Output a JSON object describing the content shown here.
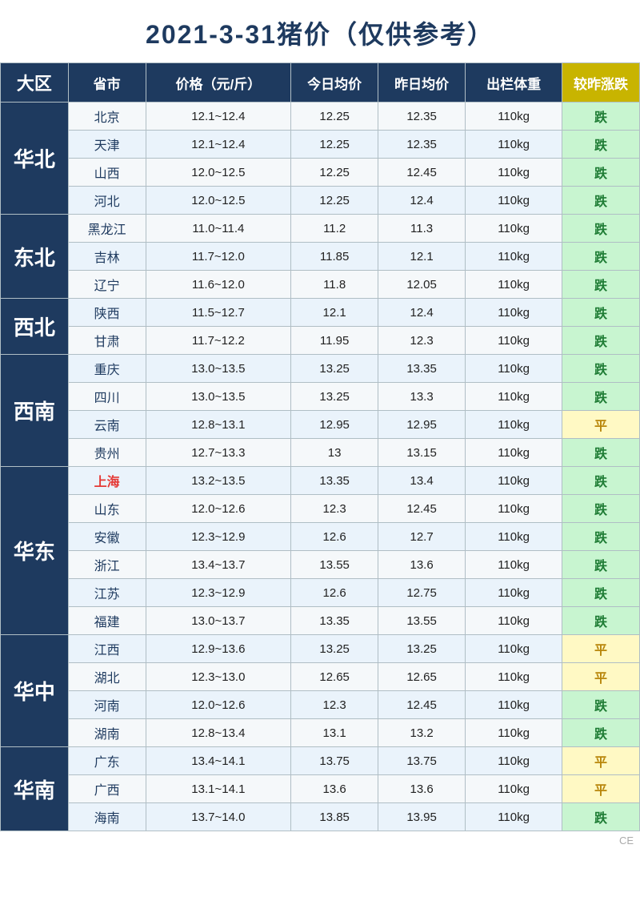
{
  "title": "2021-3-31猪价（仅供参考）",
  "headers": {
    "region": "大区",
    "province": "省市",
    "price": "价格（元/斤）",
    "today_avg": "今日均价",
    "yesterday_avg": "昨日均价",
    "weight": "出栏体重",
    "change": "较昨涨跌"
  },
  "regions": [
    {
      "name": "华北",
      "rows": [
        {
          "province": "北京",
          "price": "12.1~12.4",
          "today": "12.25",
          "yesterday": "12.35",
          "weight": "110kg",
          "change": "跌",
          "change_type": "drop",
          "province_highlight": false
        },
        {
          "province": "天津",
          "price": "12.1~12.4",
          "today": "12.25",
          "yesterday": "12.35",
          "weight": "110kg",
          "change": "跌",
          "change_type": "drop",
          "province_highlight": false
        },
        {
          "province": "山西",
          "price": "12.0~12.5",
          "today": "12.25",
          "yesterday": "12.45",
          "weight": "110kg",
          "change": "跌",
          "change_type": "drop",
          "province_highlight": false
        },
        {
          "province": "河北",
          "price": "12.0~12.5",
          "today": "12.25",
          "yesterday": "12.4",
          "weight": "110kg",
          "change": "跌",
          "change_type": "drop",
          "province_highlight": false
        }
      ]
    },
    {
      "name": "东北",
      "rows": [
        {
          "province": "黑龙江",
          "price": "11.0~11.4",
          "today": "11.2",
          "yesterday": "11.3",
          "weight": "110kg",
          "change": "跌",
          "change_type": "drop",
          "province_highlight": false
        },
        {
          "province": "吉林",
          "price": "11.7~12.0",
          "today": "11.85",
          "yesterday": "12.1",
          "weight": "110kg",
          "change": "跌",
          "change_type": "drop",
          "province_highlight": false
        },
        {
          "province": "辽宁",
          "price": "11.6~12.0",
          "today": "11.8",
          "yesterday": "12.05",
          "weight": "110kg",
          "change": "跌",
          "change_type": "drop",
          "province_highlight": false
        }
      ]
    },
    {
      "name": "西北",
      "rows": [
        {
          "province": "陕西",
          "price": "11.5~12.7",
          "today": "12.1",
          "yesterday": "12.4",
          "weight": "110kg",
          "change": "跌",
          "change_type": "drop",
          "province_highlight": false
        },
        {
          "province": "甘肃",
          "price": "11.7~12.2",
          "today": "11.95",
          "yesterday": "12.3",
          "weight": "110kg",
          "change": "跌",
          "change_type": "drop",
          "province_highlight": false
        }
      ]
    },
    {
      "name": "西南",
      "rows": [
        {
          "province": "重庆",
          "price": "13.0~13.5",
          "today": "13.25",
          "yesterday": "13.35",
          "weight": "110kg",
          "change": "跌",
          "change_type": "drop",
          "province_highlight": false
        },
        {
          "province": "四川",
          "price": "13.0~13.5",
          "today": "13.25",
          "yesterday": "13.3",
          "weight": "110kg",
          "change": "跌",
          "change_type": "drop",
          "province_highlight": false
        },
        {
          "province": "云南",
          "price": "12.8~13.1",
          "today": "12.95",
          "yesterday": "12.95",
          "weight": "110kg",
          "change": "平",
          "change_type": "flat",
          "province_highlight": false
        },
        {
          "province": "贵州",
          "price": "12.7~13.3",
          "today": "13",
          "yesterday": "13.15",
          "weight": "110kg",
          "change": "跌",
          "change_type": "drop",
          "province_highlight": false
        }
      ]
    },
    {
      "name": "华东",
      "rows": [
        {
          "province": "上海",
          "price": "13.2~13.5",
          "today": "13.35",
          "yesterday": "13.4",
          "weight": "110kg",
          "change": "跌",
          "change_type": "drop",
          "province_highlight": true
        },
        {
          "province": "山东",
          "price": "12.0~12.6",
          "today": "12.3",
          "yesterday": "12.45",
          "weight": "110kg",
          "change": "跌",
          "change_type": "drop",
          "province_highlight": false
        },
        {
          "province": "安徽",
          "price": "12.3~12.9",
          "today": "12.6",
          "yesterday": "12.7",
          "weight": "110kg",
          "change": "跌",
          "change_type": "drop",
          "province_highlight": false
        },
        {
          "province": "浙江",
          "price": "13.4~13.7",
          "today": "13.55",
          "yesterday": "13.6",
          "weight": "110kg",
          "change": "跌",
          "change_type": "drop",
          "province_highlight": false
        },
        {
          "province": "江苏",
          "price": "12.3~12.9",
          "today": "12.6",
          "yesterday": "12.75",
          "weight": "110kg",
          "change": "跌",
          "change_type": "drop",
          "province_highlight": false
        },
        {
          "province": "福建",
          "price": "13.0~13.7",
          "today": "13.35",
          "yesterday": "13.55",
          "weight": "110kg",
          "change": "跌",
          "change_type": "drop",
          "province_highlight": false
        }
      ]
    },
    {
      "name": "华中",
      "rows": [
        {
          "province": "江西",
          "price": "12.9~13.6",
          "today": "13.25",
          "yesterday": "13.25",
          "weight": "110kg",
          "change": "平",
          "change_type": "flat",
          "province_highlight": false
        },
        {
          "province": "湖北",
          "price": "12.3~13.0",
          "today": "12.65",
          "yesterday": "12.65",
          "weight": "110kg",
          "change": "平",
          "change_type": "flat",
          "province_highlight": false
        },
        {
          "province": "河南",
          "price": "12.0~12.6",
          "today": "12.3",
          "yesterday": "12.45",
          "weight": "110kg",
          "change": "跌",
          "change_type": "drop",
          "province_highlight": false
        },
        {
          "province": "湖南",
          "price": "12.8~13.4",
          "today": "13.1",
          "yesterday": "13.2",
          "weight": "110kg",
          "change": "跌",
          "change_type": "drop",
          "province_highlight": false
        }
      ]
    },
    {
      "name": "华南",
      "rows": [
        {
          "province": "广东",
          "price": "13.4~14.1",
          "today": "13.75",
          "yesterday": "13.75",
          "weight": "110kg",
          "change": "平",
          "change_type": "flat",
          "province_highlight": false
        },
        {
          "province": "广西",
          "price": "13.1~14.1",
          "today": "13.6",
          "yesterday": "13.6",
          "weight": "110kg",
          "change": "平",
          "change_type": "flat",
          "province_highlight": false
        },
        {
          "province": "海南",
          "price": "13.7~14.0",
          "today": "13.85",
          "yesterday": "13.95",
          "weight": "110kg",
          "change": "跌",
          "change_type": "drop",
          "province_highlight": false
        }
      ]
    }
  ],
  "footer": "CE"
}
